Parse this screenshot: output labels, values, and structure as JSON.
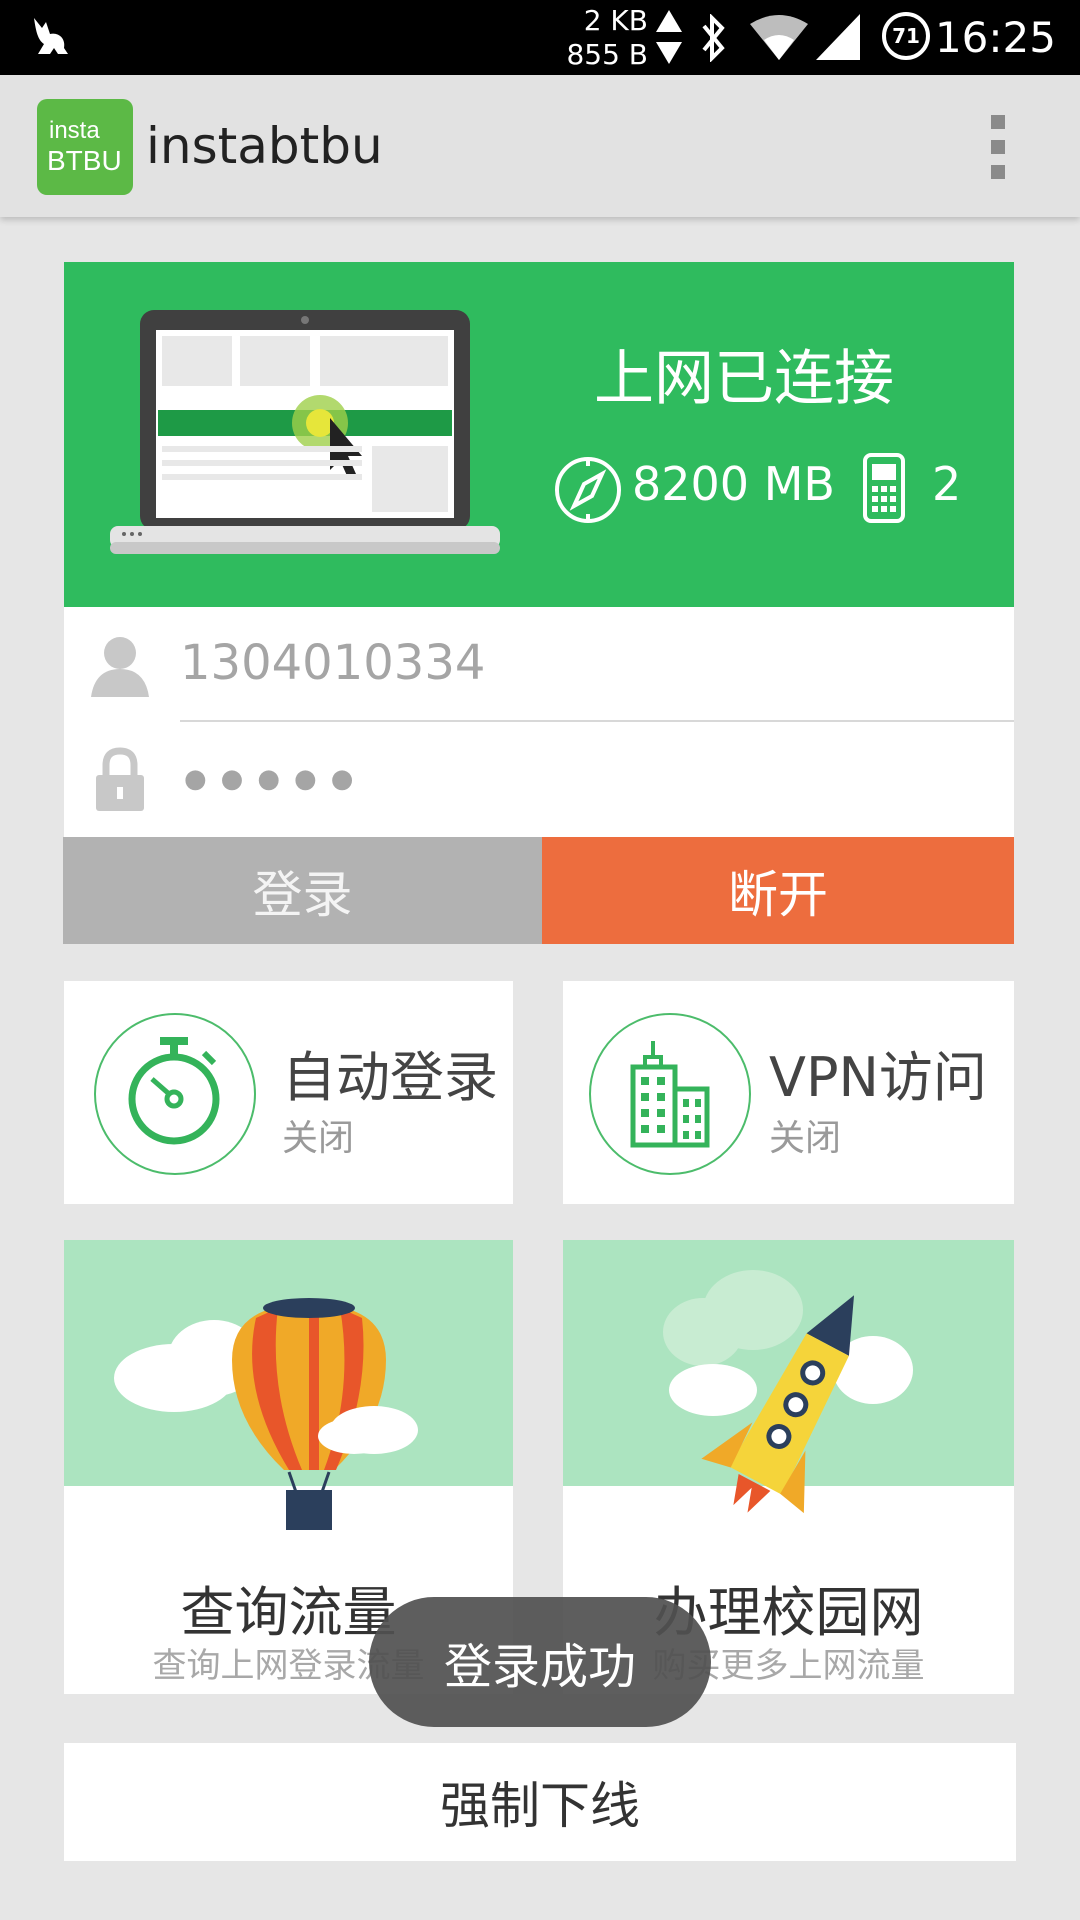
{
  "status_bar": {
    "upload_rate": "2 KB",
    "download_rate": "855 B",
    "battery": "71",
    "time": "16:25"
  },
  "app_bar": {
    "logo_text_top": "insta",
    "logo_text_bottom": "BTBU",
    "title": "instabtbu",
    "menu_icon": "overflow-menu-icon"
  },
  "status_card": {
    "status_text": "上网已连接",
    "traffic": "8200 MB",
    "devices": "2",
    "colors": {
      "background": "#2fbb5e"
    }
  },
  "login": {
    "username_value": "1304010334",
    "password_mask": "●●●●●",
    "login_label": "登录",
    "disconnect_label": "断开"
  },
  "options": {
    "auto_login": {
      "title": "自动登录",
      "state": "关闭"
    },
    "vpn": {
      "title": "VPN访问",
      "state": "关闭"
    }
  },
  "cards": {
    "query": {
      "title": "查询流量",
      "subtitle": "查询上网登录流量"
    },
    "campus": {
      "title": "办理校园网",
      "subtitle": "购买更多上网流量"
    }
  },
  "force_offline_label": "强制下线",
  "toast": "登录成功"
}
